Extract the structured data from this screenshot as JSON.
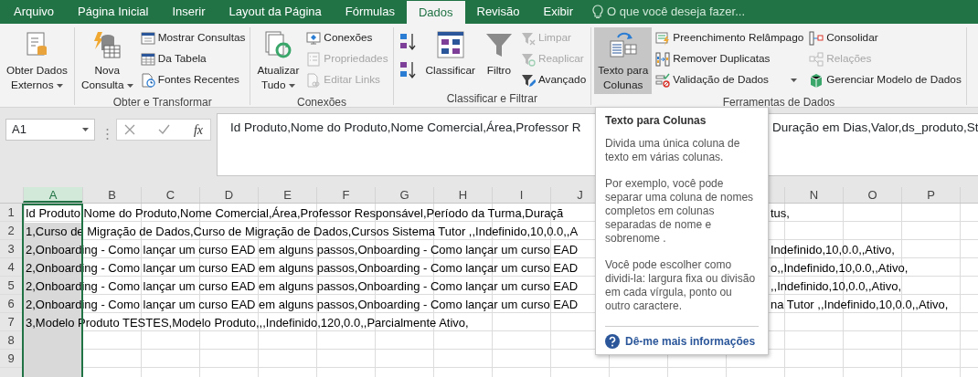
{
  "tabs": [
    {
      "label": "Arquivo",
      "selected": false
    },
    {
      "label": "Página Inicial",
      "selected": false
    },
    {
      "label": "Inserir",
      "selected": false
    },
    {
      "label": "Layout da Página",
      "selected": false
    },
    {
      "label": "Fórmulas",
      "selected": false
    },
    {
      "label": "Dados",
      "selected": true
    },
    {
      "label": "Revisão",
      "selected": false
    },
    {
      "label": "Exibir",
      "selected": false
    }
  ],
  "tell_me": {
    "placeholder": "O que você deseja fazer..."
  },
  "ribbon_groups": [
    {
      "items": [
        {
          "kind": "large",
          "lines": [
            "Obter Dados",
            "Externos"
          ],
          "dropdown": true,
          "selected": false
        }
      ]
    },
    {
      "label": "Obter e Transformar",
      "items": [
        {
          "kind": "large",
          "lines": [
            "Nova",
            "Consulta"
          ],
          "dropdown": true,
          "selected": false
        },
        {
          "kind": "stack",
          "buttons": [
            {
              "label": "Mostrar Consultas",
              "disabled": false
            },
            {
              "label": "Da Tabela",
              "disabled": false
            },
            {
              "label": "Fontes Recentes",
              "disabled": false
            }
          ]
        }
      ]
    },
    {
      "label": "Conexões",
      "items": [
        {
          "kind": "large",
          "lines": [
            "Atualizar",
            "Tudo"
          ],
          "dropdown": true,
          "selected": false
        },
        {
          "kind": "stack",
          "buttons": [
            {
              "label": "Conexões",
              "disabled": false
            },
            {
              "label": "Propriedades",
              "disabled": true
            },
            {
              "label": "Editar Links",
              "disabled": true
            }
          ]
        }
      ]
    },
    {
      "label": "Classificar e Filtrar",
      "items": [
        {
          "kind": "sortpair"
        },
        {
          "kind": "large",
          "lines": [
            "Classificar"
          ],
          "dropdown": false,
          "selected": false
        },
        {
          "kind": "large",
          "lines": [
            "Filtro"
          ],
          "dropdown": false,
          "selected": false
        },
        {
          "kind": "stack",
          "buttons": [
            {
              "label": "Limpar",
              "disabled": true
            },
            {
              "label": "Reaplicar",
              "disabled": true
            },
            {
              "label": "Avançado",
              "disabled": false
            }
          ]
        }
      ]
    },
    {
      "label": "Ferramentas de Dados",
      "items": [
        {
          "kind": "large",
          "lines": [
            "Texto para",
            "Colunas"
          ],
          "dropdown": false,
          "selected": true
        },
        {
          "kind": "stack",
          "buttons": [
            {
              "label": "Preenchimento Relâmpago",
              "disabled": false
            },
            {
              "label": "Remover Duplicatas",
              "disabled": false
            },
            {
              "label": "Validação de Dados",
              "disabled": false,
              "dropdown": true
            }
          ]
        },
        {
          "kind": "stack",
          "buttons": [
            {
              "label": "Consolidar",
              "disabled": false
            },
            {
              "label": "Relações",
              "disabled": true
            },
            {
              "label": "Gerenciar Modelo de Dados",
              "disabled": false
            }
          ]
        }
      ]
    }
  ],
  "name_box": "A1",
  "function_button": "fx",
  "formula": {
    "text": "Id Produto,Nome do Produto,Nome Comercial,Área,Professor R",
    "text_right": "Duração em Dias,Valor,ds_produto,St"
  },
  "columns": [
    {
      "label": "A",
      "selected": true
    },
    {
      "label": "B",
      "selected": false
    },
    {
      "label": "C",
      "selected": false
    },
    {
      "label": "D",
      "selected": false
    },
    {
      "label": "E",
      "selected": false
    },
    {
      "label": "F",
      "selected": false
    },
    {
      "label": "G",
      "selected": false
    },
    {
      "label": "H",
      "selected": false
    },
    {
      "label": "I",
      "selected": false
    },
    {
      "label": "J",
      "selected": false
    }
  ],
  "columns_right": [
    {
      "label": "N",
      "selected": false
    },
    {
      "label": "O",
      "selected": false
    },
    {
      "label": "P",
      "selected": false
    }
  ],
  "rows": [
    {
      "number": "1",
      "text": "Id Produto,Nome do Produto,Nome Comercial,Área,Professor Responsável,Período da Turma,Duraçã",
      "text_right": "tus,"
    },
    {
      "number": "2",
      "text": "1,Curso de Migração de Dados,Curso de Migração de Dados,Cursos Sistema Tutor ,,Indefinido,10,0.0,,A"
    },
    {
      "number": "3",
      "text": "2,Onboarding - Como lançar um curso EAD em alguns passos,Onboarding - Como lançar um curso EAD",
      "text_right": "Indefinido,10,0.0,,Ativo,"
    },
    {
      "number": "4",
      "text": "2,Onboarding - Como lançar um curso EAD em alguns passos,Onboarding - Como lançar um curso EAD",
      "text_right": "o,,Indefinido,10,0.0,,Ativo,"
    },
    {
      "number": "5",
      "text": "2,Onboarding - Como lançar um curso EAD em alguns passos,Onboarding - Como lançar um curso EAD",
      "text_right": ",,Indefinido,10,0.0,,Ativo,"
    },
    {
      "number": "6",
      "text": "2,Onboarding - Como lançar um curso EAD em alguns passos,Onboarding - Como lançar um curso EAD",
      "text_right": "na Tutor ,,Indefinido,10,0.0,,Ativo,"
    },
    {
      "number": "7",
      "text": "3,Modelo Produto TESTES,Modelo Produto,,,Indefinido,120,0.0,,Parcialmente Ativo,"
    },
    {
      "number": "8"
    },
    {
      "number": "9"
    }
  ],
  "tooltip": {
    "title": "Texto para Colunas",
    "paragraphs": [
      "Divida uma única coluna de texto em várias colunas.",
      "Por exemplo, você pode separar uma coluna de nomes completos em colunas separadas de nome e sobrenome .",
      "Você pode escolher como dividi-la: largura fixa ou divisão em cada vírgula, ponto ou outro caractere."
    ],
    "link": "Dê-me mais informações"
  }
}
